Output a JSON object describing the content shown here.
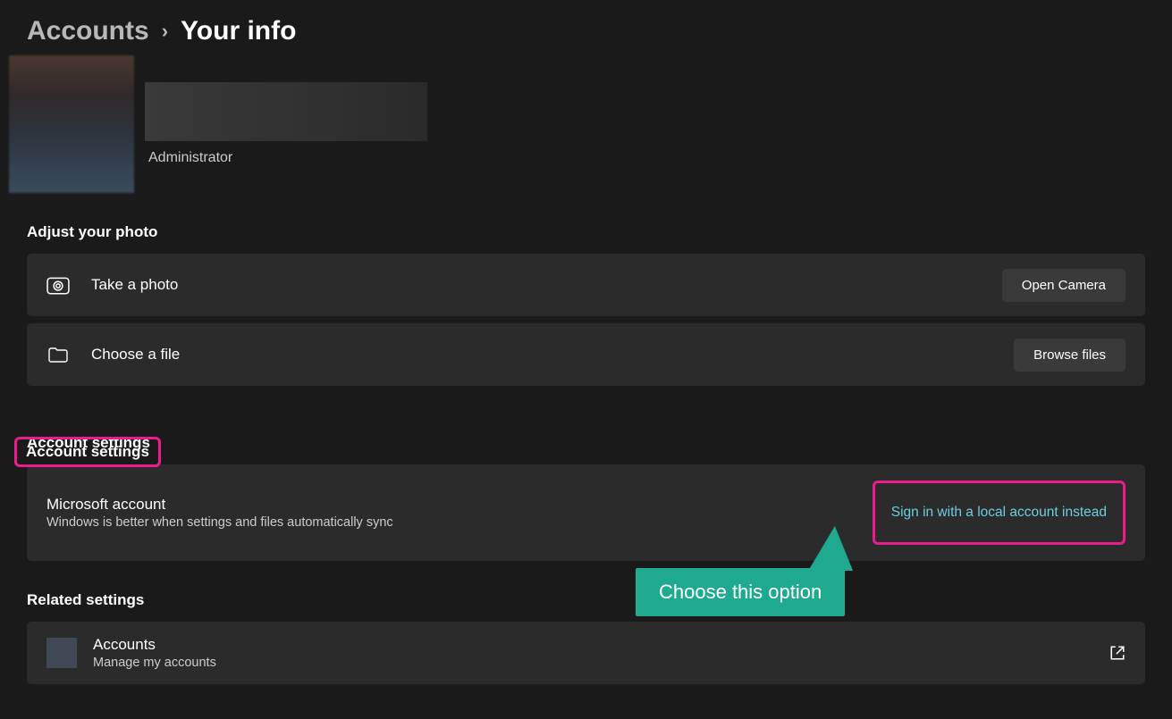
{
  "breadcrumb": {
    "parent": "Accounts",
    "current": "Your info"
  },
  "profile": {
    "role": "Administrator"
  },
  "photo_section": {
    "title": "Adjust your photo",
    "rows": [
      {
        "label": "Take a photo",
        "button": "Open Camera"
      },
      {
        "label": "Choose a file",
        "button": "Browse files"
      }
    ]
  },
  "account_section": {
    "title": "Account settings",
    "row": {
      "title": "Microsoft account",
      "sub": "Windows is better when settings and files automatically sync",
      "action": "Sign in with a local account instead"
    }
  },
  "related_section": {
    "title": "Related settings",
    "row": {
      "title": "Accounts",
      "sub": "Manage my accounts"
    }
  },
  "annotation": {
    "callout": "Choose this option"
  }
}
